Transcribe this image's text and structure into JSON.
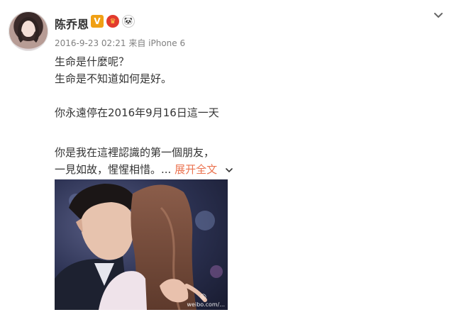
{
  "post": {
    "author_name": "陈乔恩",
    "badges": {
      "verified": "V",
      "vip": "♛",
      "panda": "🐼"
    },
    "timestamp": "2016-9-23 02:21",
    "source": "来自 iPhone 6",
    "lines": [
      "生命是什麼呢？",
      "生命是不知道如何是好。",
      "你永遠停在2016年9月16日這一天",
      "你是我在這裡認識的第一個朋友，",
      "一見如故，惺惺相惜。..."
    ],
    "expand_label": "展开全文",
    "photo_watermark": "weibo.com/..."
  },
  "colors": {
    "accent": "#eb7350",
    "meta_gray": "#808080",
    "text": "#333333"
  }
}
